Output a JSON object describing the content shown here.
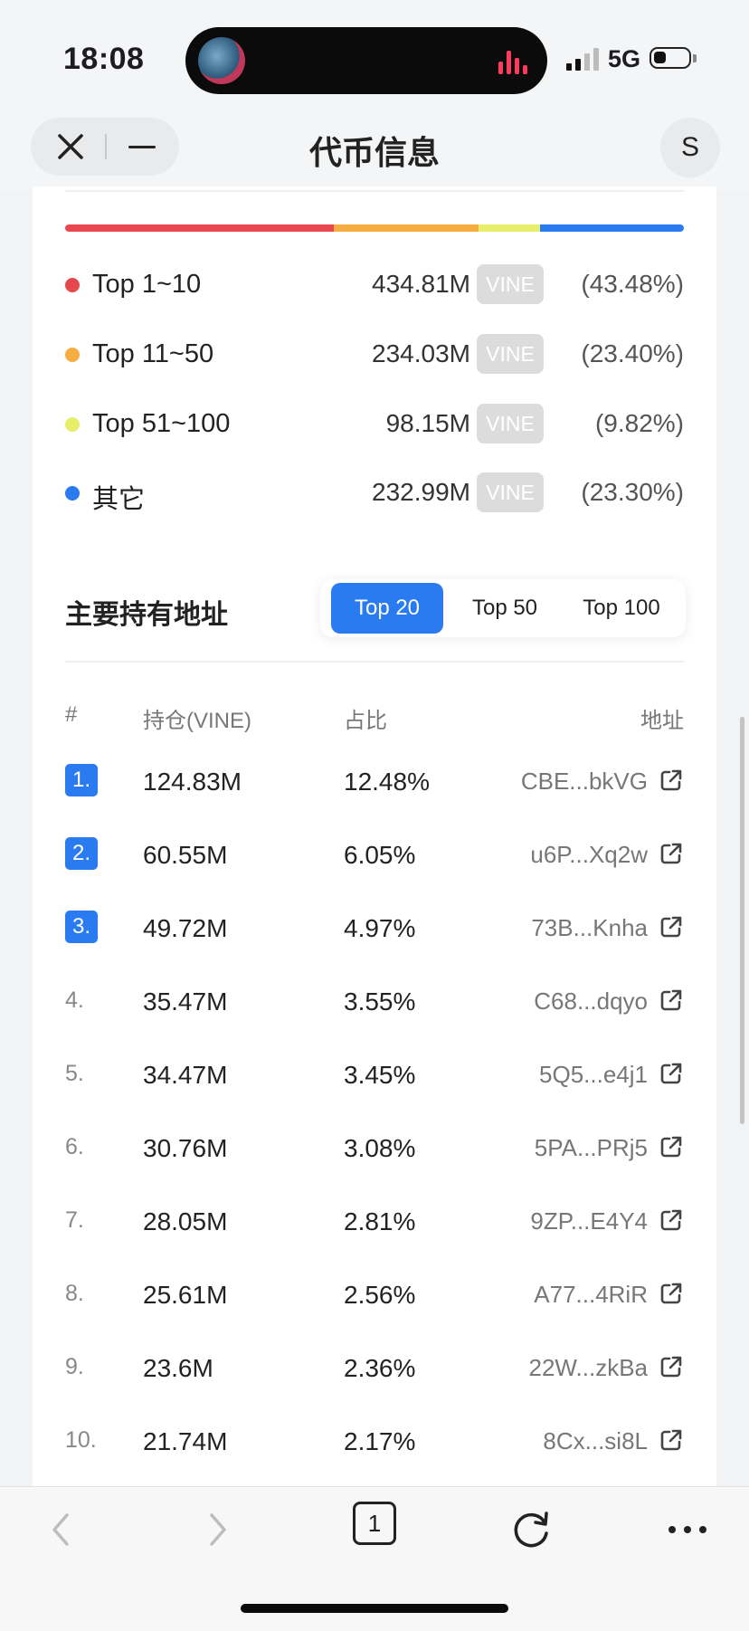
{
  "status_bar": {
    "time": "18:08",
    "network": "5G"
  },
  "nav": {
    "title": "代币信息",
    "profile_initial": "S"
  },
  "distribution": {
    "bar": [
      {
        "share": 0.4348,
        "color": "#e8474f"
      },
      {
        "share": 0.234,
        "color": "#f5ad42"
      },
      {
        "share": 0.0982,
        "color": "#e6ee6a"
      },
      {
        "share": 0.233,
        "color": "#2b7bf0"
      }
    ],
    "rows": [
      {
        "name": "Top 1~10",
        "amount": "434.81M",
        "unit": "VINE",
        "pct": "(43.48%)",
        "color": "#e8474f"
      },
      {
        "name": "Top 11~50",
        "amount": "234.03M",
        "unit": "VINE",
        "pct": "(23.40%)",
        "color": "#f5ad42"
      },
      {
        "name": "Top 51~100",
        "amount": "98.15M",
        "unit": "VINE",
        "pct": "(9.82%)",
        "color": "#e6ee6a"
      },
      {
        "name": "其它",
        "amount": "232.99M",
        "unit": "VINE",
        "pct": "(23.30%)",
        "color": "#2b7bf0"
      }
    ]
  },
  "holders": {
    "title": "主要持有地址",
    "tabs": [
      {
        "label": "Top 20",
        "active": true
      },
      {
        "label": "Top 50",
        "active": false
      },
      {
        "label": "Top 100",
        "active": false
      }
    ],
    "columns": {
      "rank": "#",
      "holding": "持仓(VINE)",
      "ratio": "占比",
      "address": "地址"
    },
    "rows": [
      {
        "rank": "1.",
        "holding": "124.83M",
        "ratio": "12.48%",
        "address": "CBE...bkVG",
        "highlight": true
      },
      {
        "rank": "2.",
        "holding": "60.55M",
        "ratio": "6.05%",
        "address": "u6P...Xq2w",
        "highlight": true
      },
      {
        "rank": "3.",
        "holding": "49.72M",
        "ratio": "4.97%",
        "address": "73B...Knha",
        "highlight": true
      },
      {
        "rank": "4.",
        "holding": "35.47M",
        "ratio": "3.55%",
        "address": "C68...dqyo",
        "highlight": false
      },
      {
        "rank": "5.",
        "holding": "34.47M",
        "ratio": "3.45%",
        "address": "5Q5...e4j1",
        "highlight": false
      },
      {
        "rank": "6.",
        "holding": "30.76M",
        "ratio": "3.08%",
        "address": "5PA...PRj5",
        "highlight": false
      },
      {
        "rank": "7.",
        "holding": "28.05M",
        "ratio": "2.81%",
        "address": "9ZP...E4Y4",
        "highlight": false
      },
      {
        "rank": "8.",
        "holding": "25.61M",
        "ratio": "2.56%",
        "address": "A77...4RiR",
        "highlight": false
      },
      {
        "rank": "9.",
        "holding": "23.6M",
        "ratio": "2.36%",
        "address": "22W...zkBa",
        "highlight": false
      },
      {
        "rank": "10.",
        "holding": "21.74M",
        "ratio": "2.17%",
        "address": "8Cx...si8L",
        "highlight": false
      }
    ]
  },
  "bottom_bar": {
    "tab_count": "1"
  },
  "icons": {
    "close": "close-icon",
    "minimize": "minus-icon",
    "back": "chevron-left-icon",
    "forward": "chevron-right-icon",
    "reload": "reload-icon",
    "more": "more-icon",
    "external": "external-link-icon"
  }
}
